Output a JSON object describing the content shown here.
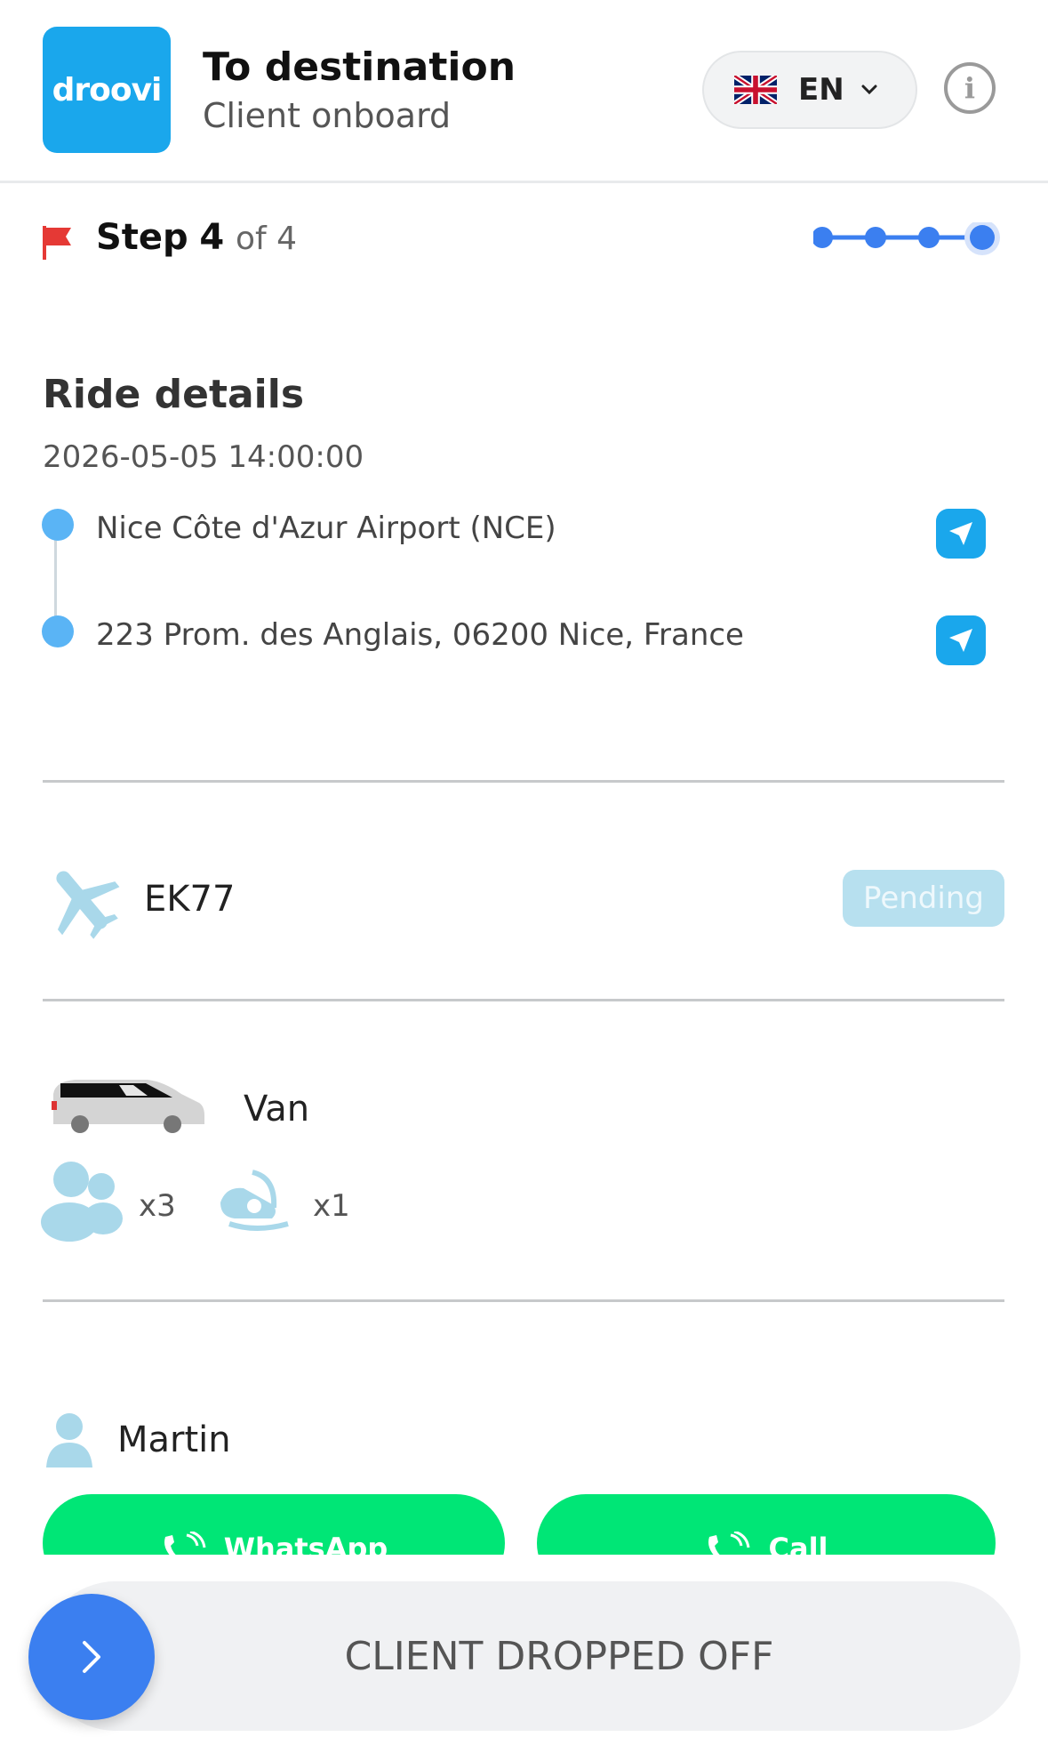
{
  "header": {
    "logo_text": "droovi",
    "title": "To destination",
    "subtitle": "Client onboard",
    "language": "EN",
    "flag_icon": "uk-flag-icon",
    "info_icon": "info-icon",
    "accent_color": "#1aa7ec"
  },
  "step": {
    "label": "Step",
    "current": "4",
    "of_text": "of 4",
    "progress_dot_color": "#3b7ff0",
    "completed_steps": 4,
    "total_steps": 4
  },
  "ride": {
    "section_title": "Ride details",
    "datetime": "2026-05-05 14:00:00",
    "pickup": "Nice Côte d'Azur Airport (NCE)",
    "dropoff": "223 Prom. des Anglais, 06200 Nice, France",
    "nav_icon": "navigation-arrow-icon"
  },
  "flight": {
    "number": "EK77",
    "status": "Pending",
    "icon": "plane-icon"
  },
  "vehicle": {
    "type": "Van",
    "passengers": "x3",
    "child_seats": "x1"
  },
  "client": {
    "name": "Martin",
    "whatsapp_label": "WhatsApp",
    "call_label": "Call",
    "action_color": "#00e676"
  },
  "footer": {
    "slide_label": "CLIENT DROPPED OFF",
    "slide_color": "#3b7ff0"
  }
}
